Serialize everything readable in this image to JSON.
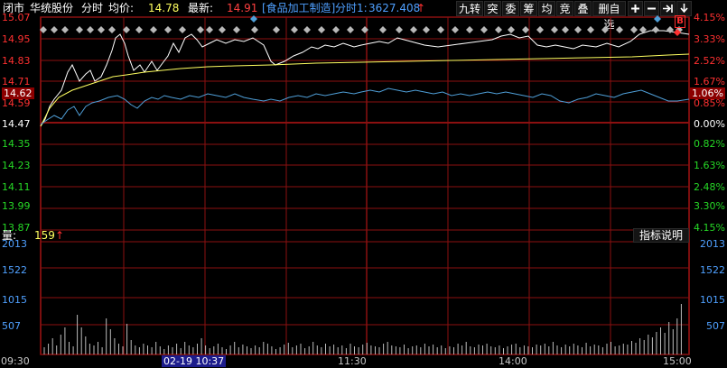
{
  "header": {
    "status": "闭市",
    "stock_name": "华统股份",
    "mode": "分时",
    "avg_label": "均价:",
    "avg_value": "14.78",
    "latest_label": "最新:",
    "latest_value": "14.91",
    "industry": "[食品加工制造]",
    "tick_label": "分时1:",
    "tick_value": "3627.408",
    "up_arrow": "↑"
  },
  "toolbar": {
    "buttons": [
      "九转",
      "突",
      "委",
      "筹",
      "均",
      "竞",
      "叠",
      "删自选"
    ],
    "icons": [
      "plus-icon",
      "minus-icon",
      "arrow-right-icon",
      "arrow-down-icon"
    ]
  },
  "price_axis": {
    "left": [
      "15.07",
      "14.95",
      "14.83",
      "14.71",
      "14.62",
      "14.59",
      "14.47",
      "14.35",
      "14.23",
      "14.11",
      "13.99",
      "13.87"
    ],
    "right": [
      "4.15%",
      "3.33%",
      "2.52%",
      "1.67%",
      "1.06%",
      "0.85%",
      "0.00%",
      "0.82%",
      "1.63%",
      "2.48%",
      "3.30%",
      "4.15%"
    ],
    "highlight_left": "14.62",
    "highlight_right": "1.06%"
  },
  "volume": {
    "label": "量:",
    "value": "159",
    "arrow": "↑",
    "help_button": "指标说明",
    "axis": [
      "2013",
      "1522",
      "1015",
      "507"
    ]
  },
  "time_axis": [
    "09:30",
    "02-19 10:37",
    "11:30",
    "14:00",
    "15:00"
  ],
  "marker": "B",
  "colors": {
    "price_line": "#ffffff",
    "avg_line": "#ffff60",
    "index_line": "#4f9fd8",
    "grid": "#8b1010",
    "up": "#ff3030",
    "down": "#26d926",
    "volume_bar": "#bcbcbc",
    "selected_date_bg": "#1c1c8c"
  }
}
